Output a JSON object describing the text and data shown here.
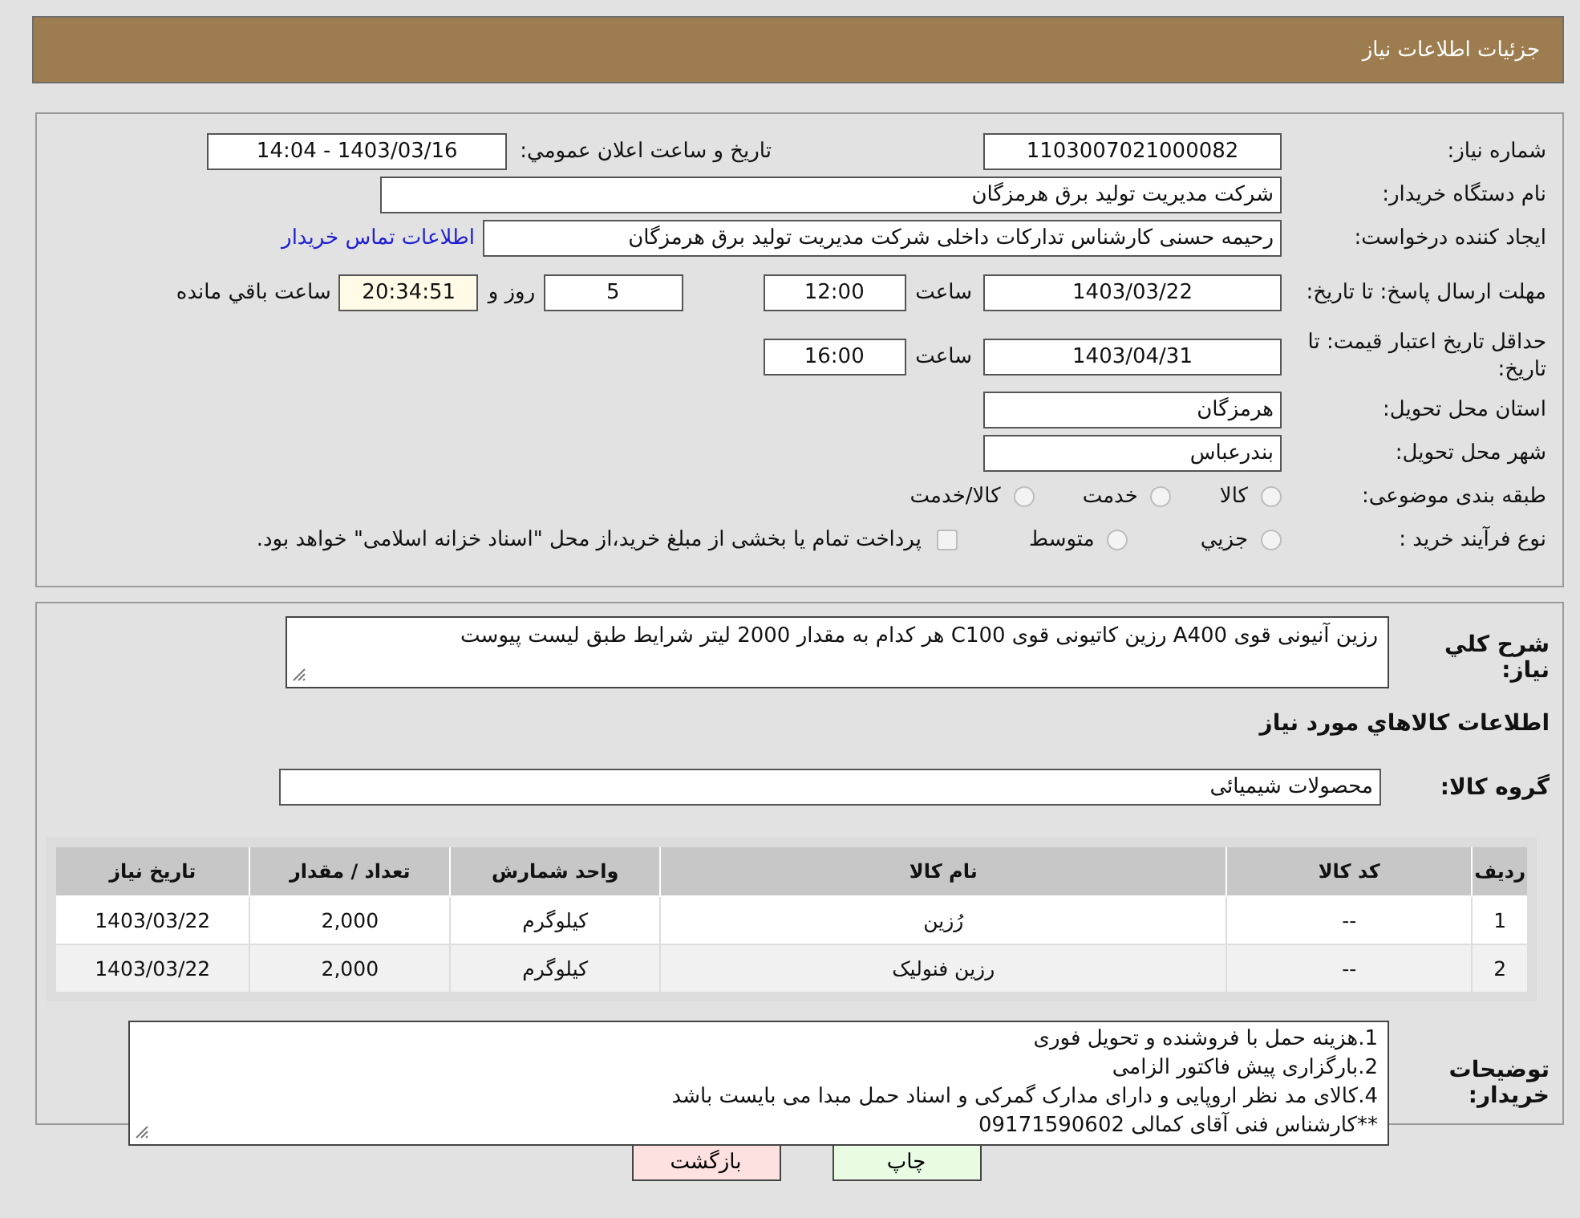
{
  "header": {
    "title": "جزئیات اطلاعات نیاز"
  },
  "need_number": {
    "label": "شماره نیاز:",
    "value": "1103007021000082"
  },
  "announce": {
    "label": "تاریخ و ساعت اعلان عمومي:",
    "value": "1403/03/16 - 14:04"
  },
  "buyer": {
    "label": "نام دستگاه خریدار:",
    "value": "شرکت مدیریت تولید برق هرمزگان"
  },
  "requester": {
    "label": "ایجاد کننده درخواست:",
    "value": "رحیمه حسنی کارشناس تدارکات داخلی شرکت مدیریت تولید برق هرمزگان",
    "link": "اطلاعات تماس خریدار"
  },
  "reply_deadline": {
    "label": "مهلت ارسال پاسخ: تا تاریخ:",
    "date": "1403/03/22",
    "time_label": "ساعت",
    "time": "12:00",
    "days": "5",
    "days_label": "روز و",
    "remaining": "20:34:51",
    "remaining_label": "ساعت باقي مانده"
  },
  "price_validity": {
    "label": "حداقل تاریخ اعتبار قیمت: تا تاریخ:",
    "date": "1403/04/31",
    "time_label": "ساعت",
    "time": "16:00"
  },
  "province": {
    "label": "استان محل تحویل:",
    "value": "هرمزگان"
  },
  "city": {
    "label": "شهر محل تحویل:",
    "value": "بندرعباس"
  },
  "subject_category": {
    "label": "طبقه بندی موضوعی:",
    "options": [
      {
        "label": "کالا",
        "selected": false
      },
      {
        "label": "خدمت",
        "selected": false
      },
      {
        "label": "کالا/خدمت",
        "selected": false
      }
    ]
  },
  "purchase_type": {
    "label": "نوع فرآیند خرید :",
    "options": [
      {
        "label": "جزيي",
        "selected": false
      },
      {
        "label": "متوسط",
        "selected": false
      }
    ],
    "treasury": {
      "label": "پرداخت تمام یا بخشی از مبلغ خرید،از محل \"اسناد خزانه اسلامی\" خواهد بود.",
      "checked": false
    }
  },
  "description": {
    "label": "شرح کلي نياز:",
    "value": "رزین آنیونی قوی A400    رزین کاتیونی قوی  C100  هر کدام به مقدار 2000 لیتر شرایط طبق لیست پیوست"
  },
  "goods_heading": "اطلاعات کالاهاي مورد نياز",
  "goods_group": {
    "label": "گروه کالا:",
    "value": "محصولات شیمیائی"
  },
  "table": {
    "columns": [
      "ردیف",
      "کد کالا",
      "نام کالا",
      "واحد شمارش",
      "تعداد / مقدار",
      "تاریخ نیاز"
    ],
    "rows": [
      [
        "1",
        "--",
        "رُزین",
        "کیلوگرم",
        "2,000",
        "1403/03/22"
      ],
      [
        "2",
        "--",
        "رزین فنولیک",
        "کیلوگرم",
        "2,000",
        "1403/03/22"
      ]
    ]
  },
  "buyer_notes": {
    "label": "توضیحات خریدار:",
    "lines": [
      "1.هزینه حمل با فروشنده و تحویل فوری",
      "2.بارگزاری پیش فاکتور الزامی",
      "4.کالای مد نظر اروپایی و دارای مدارک گمرکی و اسناد حمل مبدا می بایست باشد",
      "**کارشناس فنی آقای کمالی 09171590602"
    ]
  },
  "buttons": [
    {
      "label": "چاپ",
      "kind": "print"
    },
    {
      "label": "بازگشت",
      "kind": "back"
    }
  ]
}
